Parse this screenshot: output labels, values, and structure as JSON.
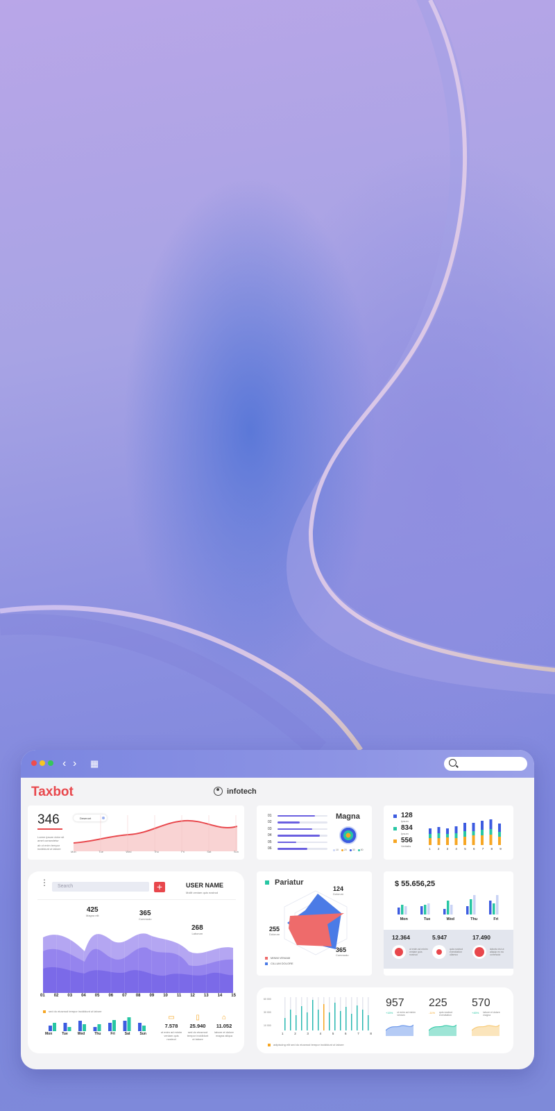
{
  "window": {
    "brand": "Taxbot",
    "account": "infotech",
    "search_placeholder": ""
  },
  "card_wave": {
    "value": "346",
    "note1": "Lorem ipsum dolor sit amet consectetur",
    "note2": "ab ut enim tempor incididunt ut labore",
    "pill": "Deserunt",
    "days": [
      "Mon",
      "Tue",
      "Wed",
      "Thu",
      "Fri",
      "Sat",
      "Sun"
    ]
  },
  "card_bars_list": {
    "title": "Magna",
    "rows": [
      {
        "label": "01",
        "value": 0.75
      },
      {
        "label": "02",
        "value": 0.45
      },
      {
        "label": "03",
        "value": 0.7
      },
      {
        "label": "04",
        "value": 0.85
      },
      {
        "label": "05",
        "value": 0.38
      },
      {
        "label": "06",
        "value": 0.6
      }
    ],
    "legend": [
      "10",
      "20",
      "30",
      "50"
    ]
  },
  "card_stacked": {
    "stats": [
      {
        "value": "128",
        "label": "Ipsum",
        "color": "#3c5be0"
      },
      {
        "value": "834",
        "label": "Ipsum",
        "color": "#27c6a3"
      },
      {
        "value": "556",
        "label": "Veritatis",
        "color": "#f6a623"
      }
    ],
    "x": [
      "1",
      "2",
      "3",
      "4",
      "5",
      "6",
      "7",
      "8",
      "9"
    ]
  },
  "card_area": {
    "search_placeholder": "Search",
    "user_name": "USER NAME",
    "user_sub": "Mollit veniam quis nostrud",
    "peaks": [
      {
        "value": "425",
        "label": "Magna elit"
      },
      {
        "value": "365",
        "label": "Commodo"
      },
      {
        "value": "268",
        "label": "Laborum"
      }
    ],
    "x": [
      "01",
      "02",
      "03",
      "04",
      "05",
      "06",
      "07",
      "08",
      "09",
      "10",
      "11",
      "12",
      "13",
      "14",
      "15"
    ],
    "note": "sed do eiusmod tempor incididunt ut labore",
    "mini_days": [
      "Mon",
      "Tue",
      "Wed",
      "Thu",
      "Fri",
      "Sat",
      "Sun"
    ],
    "devices": [
      {
        "icon": "monitor-icon",
        "value": "7.578",
        "desc": "ut enim ad minim veniam quis nostrud"
      },
      {
        "icon": "phone-icon",
        "value": "25.940",
        "desc": "sed do eiusmod tempor incididunt ut labore"
      },
      {
        "icon": "laptop-icon",
        "value": "11.052",
        "desc": "labore et dolore magna aliqua"
      }
    ]
  },
  "card_radar": {
    "title": "Pariatur",
    "labels": [
      {
        "value": "124",
        "label": "Dolorum"
      },
      {
        "value": "255",
        "label": "Dolorum"
      },
      {
        "value": "365",
        "label": "Commodo"
      }
    ],
    "legend": [
      {
        "label": "MINIM VENIAM",
        "color": "#ee6b6b"
      },
      {
        "label": "CILLUM DOLORE",
        "color": "#4b7be6"
      }
    ]
  },
  "card_money": {
    "amount": "$ 55.656,25",
    "days": [
      "Mon",
      "Tue",
      "Wed",
      "Thu",
      "Fri"
    ],
    "stats": [
      {
        "value": "12.364",
        "desc": "ut enim ad minim veniam quis nostrud"
      },
      {
        "value": "5.947",
        "desc": "quis nostrud exercitation ullamco"
      },
      {
        "value": "17.490",
        "desc": "laboris nisi ut aliquip ex ea commodo"
      }
    ]
  },
  "card_columns": {
    "y_ticks": [
      "60 000",
      "30 000",
      "10 000"
    ],
    "x": [
      "1",
      "2",
      "3",
      "4",
      "5",
      "6",
      "7",
      "8"
    ],
    "note": "adipiscing elit sed do eiusmod tempor incididunt ut labore",
    "kpis": [
      {
        "value": "957",
        "change": "+15%",
        "desc": "ut enim ad minim veniam",
        "color": "#5b8ce8",
        "change_color": "#27c6a3"
      },
      {
        "value": "225",
        "change": "-11%",
        "desc": "quis nostrud exercitation",
        "color": "#27c6a3",
        "change_color": "#f6a623"
      },
      {
        "value": "570",
        "change": "+45%",
        "desc": "labore et dolore magna",
        "color": "#f6c56a",
        "change_color": "#27c6a3"
      }
    ]
  },
  "colors": {
    "brand": "#e8474c",
    "purple": "#7b6fe8",
    "blue": "#3c5be0",
    "teal": "#27c6a3",
    "orange": "#f6a623"
  }
}
